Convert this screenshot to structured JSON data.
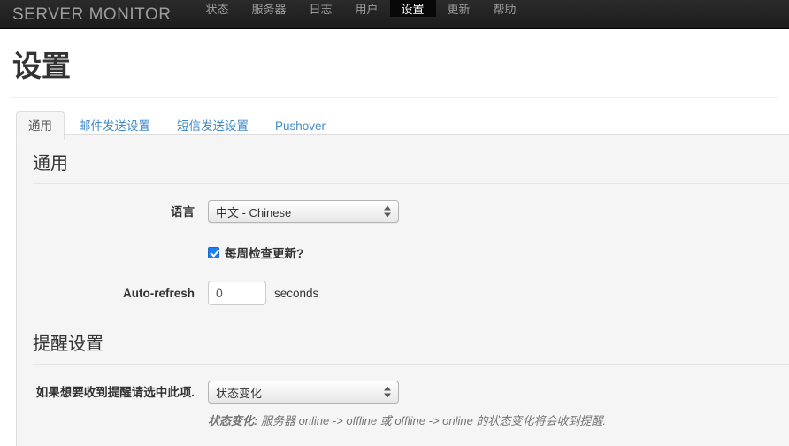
{
  "navbar": {
    "brand": "SERVER MONITOR",
    "items": [
      {
        "label": "状态",
        "active": false
      },
      {
        "label": "服务器",
        "active": false
      },
      {
        "label": "日志",
        "active": false
      },
      {
        "label": "用户",
        "active": false
      },
      {
        "label": "设置",
        "active": true
      },
      {
        "label": "更新",
        "active": false
      },
      {
        "label": "帮助",
        "active": false
      }
    ],
    "bg_color": "#222222",
    "active_bg_color": "#080808",
    "link_color": "#9d9d9d"
  },
  "page": {
    "title": "设置"
  },
  "tabs": [
    {
      "label": "通用",
      "active": true
    },
    {
      "label": "邮件发送设置",
      "active": false
    },
    {
      "label": "短信发送设置",
      "active": false
    },
    {
      "label": "Pushover",
      "active": false
    }
  ],
  "sections": {
    "general": {
      "legend": "通用",
      "language": {
        "label": "语言",
        "value": "中文 - Chinese"
      },
      "update_check": {
        "label": "每周检查更新?",
        "checked": true
      },
      "auto_refresh": {
        "label": "Auto-refresh",
        "value": "0",
        "unit": "seconds"
      }
    },
    "alerts": {
      "legend": "提醒设置",
      "alert_type": {
        "label": "如果想要收到提醒请选中此项.",
        "value": "状态变化",
        "help_strong": "状态变化:",
        "help_text": " 服务器 online -> offline 或 offline -> online 的状态变化将会收到提醒."
      }
    }
  },
  "colors": {
    "link": "#428bca",
    "panel_bg": "#f5f5f5",
    "panel_border": "#dddddd",
    "checkbox_accent": "#1a7ef5"
  }
}
